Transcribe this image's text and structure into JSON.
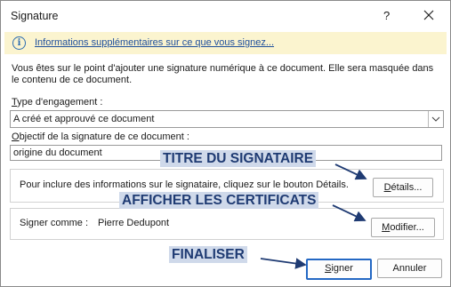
{
  "dialog": {
    "title": "Signature",
    "help_glyph": "?",
    "close_icon": "close-icon"
  },
  "infobar": {
    "icon": "info-icon",
    "link_text": "Informations supplémentaires sur ce que vous signez..."
  },
  "description": "Vous êtes sur le point d'ajouter une signature numérique à ce document. Elle sera masquée dans le contenu de ce document.",
  "commitment": {
    "label_mnemonic": "T",
    "label_rest": "ype d'engagement :",
    "selected": "A créé et approuvé ce document"
  },
  "purpose": {
    "label_mnemonic": "O",
    "label_rest": "bjectif de la signature de ce document :",
    "value": "origine du document"
  },
  "details_group": {
    "text": "Pour inclure des informations sur le signataire, cliquez sur le bouton Détails.",
    "button_mnemonic": "D",
    "button_rest": "étails..."
  },
  "sign_as_group": {
    "label": "Signer comme :",
    "name": "Pierre Dedupont",
    "button_mnemonic": "M",
    "button_rest": "odifier..."
  },
  "footer": {
    "sign_mnemonic": "S",
    "sign_rest": "igner",
    "cancel_label": "Annuler"
  },
  "annotations": {
    "signer_title": "TITRE DU SIGNATAIRE",
    "certificates": "AFFICHER LES CERTIFICATS",
    "finalize": "FINALISER"
  },
  "colors": {
    "infobar_bg": "#fbf4cf",
    "link": "#1f4f9c",
    "primary_border": "#2468c4",
    "annotation_bg": "#cfd9ea",
    "annotation_text": "#1f3b73"
  }
}
